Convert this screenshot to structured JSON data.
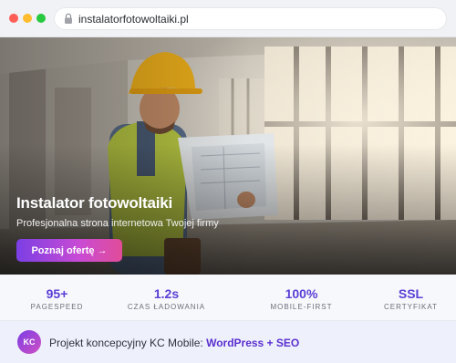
{
  "browser": {
    "url": "instalatorfotowoltaiki.pl"
  },
  "hero": {
    "title": "Instalator fotowoltaiki",
    "subtitle": "Profesjonalna strona internetowa Twojej firmy",
    "cta_label": "Poznaj ofertę →"
  },
  "stats": [
    {
      "value": "95+",
      "label": "PAGESPEED"
    },
    {
      "value": "1.2s",
      "label": "CZAS ŁADOWANIA"
    },
    {
      "value": "100%",
      "label": "MOBILE-FIRST"
    },
    {
      "value": "SSL",
      "label": "CERTYFIKAT"
    }
  ],
  "footer": {
    "badge": "KC",
    "text_prefix": "Projekt koncepcyjny KC Mobile: ",
    "text_highlight": "WordPress + SEO"
  },
  "colors": {
    "accent": "#5b3fd6",
    "gradient_start": "#7b3fe4",
    "gradient_end": "#e14c98"
  }
}
